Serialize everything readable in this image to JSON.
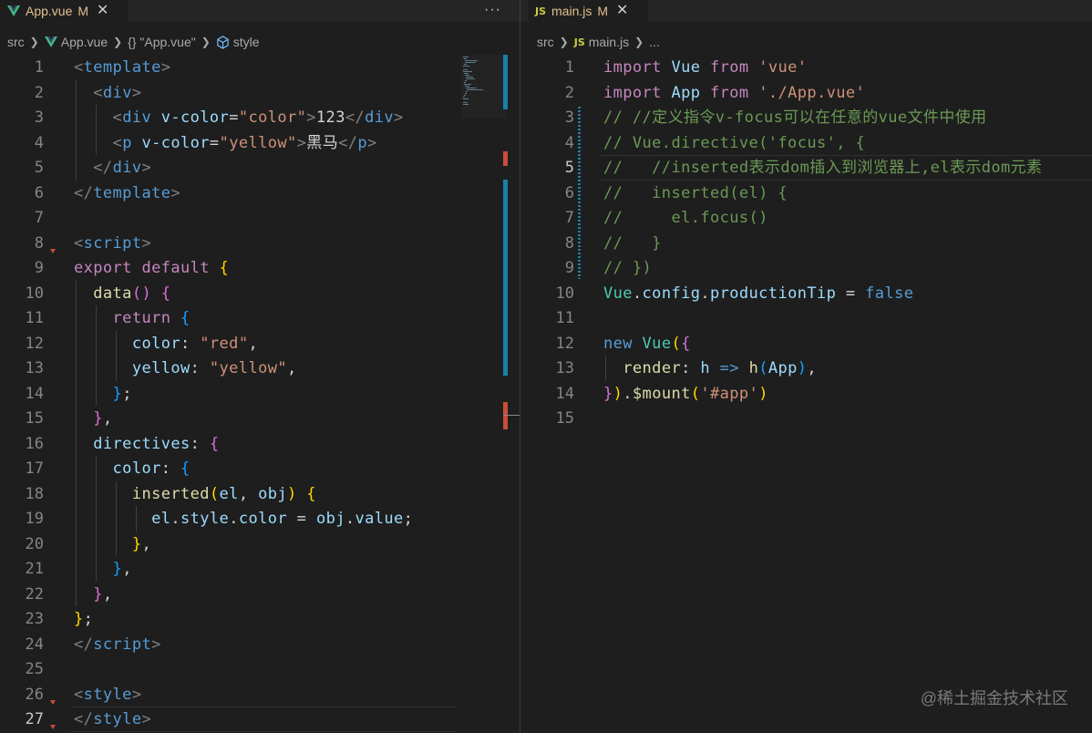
{
  "left": {
    "tab": {
      "label": "App.vue",
      "status": "M",
      "icon": "vue-icon"
    },
    "more_label": "···",
    "breadcrumb": [
      "src",
      "App.vue",
      "{} \"App.vue\"",
      "style"
    ],
    "lines": [
      {
        "n": "1",
        "tokens": [
          [
            "t-punct",
            "<"
          ],
          [
            "t-tag",
            "template"
          ],
          [
            "t-punct",
            ">"
          ]
        ]
      },
      {
        "n": "2",
        "tokens": [
          [
            "t-text",
            "  "
          ],
          [
            "t-punct",
            "<"
          ],
          [
            "t-tag",
            "div"
          ],
          [
            "t-punct",
            ">"
          ]
        ]
      },
      {
        "n": "3",
        "tokens": [
          [
            "t-text",
            "    "
          ],
          [
            "t-punct",
            "<"
          ],
          [
            "t-tag",
            "div"
          ],
          [
            "t-text",
            " "
          ],
          [
            "t-attr",
            "v-color"
          ],
          [
            "t-text",
            "="
          ],
          [
            "t-str",
            "\"color\""
          ],
          [
            "t-punct",
            ">"
          ],
          [
            "t-text",
            "123"
          ],
          [
            "t-punct",
            "</"
          ],
          [
            "t-tag",
            "div"
          ],
          [
            "t-punct",
            ">"
          ]
        ]
      },
      {
        "n": "4",
        "tokens": [
          [
            "t-text",
            "    "
          ],
          [
            "t-punct",
            "<"
          ],
          [
            "t-tag",
            "p"
          ],
          [
            "t-text",
            " "
          ],
          [
            "t-attr",
            "v-color"
          ],
          [
            "t-text",
            "="
          ],
          [
            "t-str",
            "\"yellow\""
          ],
          [
            "t-punct",
            ">"
          ],
          [
            "t-text",
            "黑马"
          ],
          [
            "t-punct",
            "</"
          ],
          [
            "t-tag",
            "p"
          ],
          [
            "t-punct",
            ">"
          ]
        ]
      },
      {
        "n": "5",
        "tokens": [
          [
            "t-text",
            "  "
          ],
          [
            "t-punct",
            "</"
          ],
          [
            "t-tag",
            "div"
          ],
          [
            "t-punct",
            ">"
          ]
        ]
      },
      {
        "n": "6",
        "tokens": [
          [
            "t-punct",
            "</"
          ],
          [
            "t-tag",
            "template"
          ],
          [
            "t-punct",
            ">"
          ]
        ]
      },
      {
        "n": "7",
        "tokens": []
      },
      {
        "n": "8",
        "tokens": [
          [
            "t-punct",
            "<"
          ],
          [
            "t-tag",
            "script"
          ],
          [
            "t-punct",
            ">"
          ]
        ]
      },
      {
        "n": "9",
        "tokens": [
          [
            "t-kw",
            "export"
          ],
          [
            "t-text",
            " "
          ],
          [
            "t-kw",
            "default"
          ],
          [
            "t-text",
            " "
          ],
          [
            "t-b1",
            "{"
          ]
        ]
      },
      {
        "n": "10",
        "tokens": [
          [
            "t-text",
            "  "
          ],
          [
            "t-fn",
            "data"
          ],
          [
            "t-b2",
            "()"
          ],
          [
            "t-text",
            " "
          ],
          [
            "t-b2",
            "{"
          ]
        ]
      },
      {
        "n": "11",
        "tokens": [
          [
            "t-text",
            "    "
          ],
          [
            "t-kw",
            "return"
          ],
          [
            "t-text",
            " "
          ],
          [
            "t-b3",
            "{"
          ]
        ]
      },
      {
        "n": "12",
        "tokens": [
          [
            "t-text",
            "      "
          ],
          [
            "t-var",
            "color"
          ],
          [
            "t-text",
            ": "
          ],
          [
            "t-str",
            "\"red\""
          ],
          [
            "t-text",
            ","
          ]
        ]
      },
      {
        "n": "13",
        "tokens": [
          [
            "t-text",
            "      "
          ],
          [
            "t-var",
            "yellow"
          ],
          [
            "t-text",
            ": "
          ],
          [
            "t-str",
            "\"yellow\""
          ],
          [
            "t-text",
            ","
          ]
        ]
      },
      {
        "n": "14",
        "tokens": [
          [
            "t-text",
            "    "
          ],
          [
            "t-b3",
            "}"
          ],
          [
            "t-text",
            ";"
          ]
        ]
      },
      {
        "n": "15",
        "tokens": [
          [
            "t-text",
            "  "
          ],
          [
            "t-b2",
            "}"
          ],
          [
            "t-text",
            ","
          ]
        ]
      },
      {
        "n": "16",
        "tokens": [
          [
            "t-text",
            "  "
          ],
          [
            "t-var",
            "directives"
          ],
          [
            "t-text",
            ": "
          ],
          [
            "t-b2",
            "{"
          ]
        ]
      },
      {
        "n": "17",
        "tokens": [
          [
            "t-text",
            "    "
          ],
          [
            "t-var",
            "color"
          ],
          [
            "t-text",
            ": "
          ],
          [
            "t-b3",
            "{"
          ]
        ]
      },
      {
        "n": "18",
        "tokens": [
          [
            "t-text",
            "      "
          ],
          [
            "t-fn",
            "inserted"
          ],
          [
            "t-b1",
            "("
          ],
          [
            "t-var",
            "el"
          ],
          [
            "t-text",
            ", "
          ],
          [
            "t-var",
            "obj"
          ],
          [
            "t-b1",
            ")"
          ],
          [
            "t-text",
            " "
          ],
          [
            "t-b1",
            "{"
          ]
        ]
      },
      {
        "n": "19",
        "tokens": [
          [
            "t-text",
            "        "
          ],
          [
            "t-var",
            "el"
          ],
          [
            "t-text",
            "."
          ],
          [
            "t-var",
            "style"
          ],
          [
            "t-text",
            "."
          ],
          [
            "t-var",
            "color"
          ],
          [
            "t-text",
            " = "
          ],
          [
            "t-var",
            "obj"
          ],
          [
            "t-text",
            "."
          ],
          [
            "t-var",
            "value"
          ],
          [
            "t-text",
            ";"
          ]
        ]
      },
      {
        "n": "20",
        "tokens": [
          [
            "t-text",
            "      "
          ],
          [
            "t-b1",
            "}"
          ],
          [
            "t-text",
            ","
          ]
        ]
      },
      {
        "n": "21",
        "tokens": [
          [
            "t-text",
            "    "
          ],
          [
            "t-b3",
            "}"
          ],
          [
            "t-text",
            ","
          ]
        ]
      },
      {
        "n": "22",
        "tokens": [
          [
            "t-text",
            "  "
          ],
          [
            "t-b2",
            "}"
          ],
          [
            "t-text",
            ","
          ]
        ]
      },
      {
        "n": "23",
        "tokens": [
          [
            "t-b1",
            "}"
          ],
          [
            "t-text",
            ";"
          ]
        ]
      },
      {
        "n": "24",
        "tokens": [
          [
            "t-punct",
            "</"
          ],
          [
            "t-tag",
            "script"
          ],
          [
            "t-punct",
            ">"
          ]
        ]
      },
      {
        "n": "25",
        "tokens": []
      },
      {
        "n": "26",
        "tokens": [
          [
            "t-punct",
            "<"
          ],
          [
            "t-tag",
            "style"
          ],
          [
            "t-punct",
            ">"
          ]
        ]
      },
      {
        "n": "27",
        "tokens": [
          [
            "t-punct",
            "</"
          ],
          [
            "t-tag",
            "style"
          ],
          [
            "t-punct",
            ">"
          ]
        ]
      }
    ]
  },
  "right": {
    "tab": {
      "label": "main.js",
      "status": "M",
      "icon_text": "JS"
    },
    "breadcrumb": [
      "src",
      "main.js",
      "..."
    ],
    "lines": [
      {
        "n": "1",
        "tokens": [
          [
            "t-kw",
            "import"
          ],
          [
            "t-text",
            " "
          ],
          [
            "t-var",
            "Vue"
          ],
          [
            "t-text",
            " "
          ],
          [
            "t-kw",
            "from"
          ],
          [
            "t-text",
            " "
          ],
          [
            "t-str",
            "'vue'"
          ]
        ]
      },
      {
        "n": "2",
        "tokens": [
          [
            "t-kw",
            "import"
          ],
          [
            "t-text",
            " "
          ],
          [
            "t-var",
            "App"
          ],
          [
            "t-text",
            " "
          ],
          [
            "t-kw",
            "from"
          ],
          [
            "t-text",
            " "
          ],
          [
            "t-str",
            "'./App.vue'"
          ]
        ]
      },
      {
        "n": "3",
        "tokens": [
          [
            "t-cmt",
            "// //定义指令v-focus可以在任意的vue文件中使用"
          ]
        ]
      },
      {
        "n": "4",
        "tokens": [
          [
            "t-cmt",
            "// Vue.directive('focus', {"
          ]
        ]
      },
      {
        "n": "5",
        "tokens": [
          [
            "t-cmt",
            "//   //inserted表示dom插入到浏览器上,el表示dom元素"
          ]
        ]
      },
      {
        "n": "6",
        "tokens": [
          [
            "t-cmt",
            "//   inserted(el) {"
          ]
        ]
      },
      {
        "n": "7",
        "tokens": [
          [
            "t-cmt",
            "//     el.focus()"
          ]
        ]
      },
      {
        "n": "8",
        "tokens": [
          [
            "t-cmt",
            "//   }"
          ]
        ]
      },
      {
        "n": "9",
        "tokens": [
          [
            "t-cmt",
            "// })"
          ]
        ]
      },
      {
        "n": "10",
        "tokens": [
          [
            "t-cls",
            "Vue"
          ],
          [
            "t-text",
            "."
          ],
          [
            "t-var",
            "config"
          ],
          [
            "t-text",
            "."
          ],
          [
            "t-var",
            "productionTip"
          ],
          [
            "t-text",
            " = "
          ],
          [
            "t-bool",
            "false"
          ]
        ]
      },
      {
        "n": "11",
        "tokens": []
      },
      {
        "n": "12",
        "tokens": [
          [
            "t-bool",
            "new"
          ],
          [
            "t-text",
            " "
          ],
          [
            "t-cls",
            "Vue"
          ],
          [
            "t-b1",
            "("
          ],
          [
            "t-b2",
            "{"
          ]
        ]
      },
      {
        "n": "13",
        "tokens": [
          [
            "t-text",
            "  "
          ],
          [
            "t-fn",
            "render"
          ],
          [
            "t-text",
            ": "
          ],
          [
            "t-var",
            "h"
          ],
          [
            "t-text",
            " "
          ],
          [
            "t-bool",
            "=>"
          ],
          [
            "t-text",
            " "
          ],
          [
            "t-fn",
            "h"
          ],
          [
            "t-b3",
            "("
          ],
          [
            "t-var",
            "App"
          ],
          [
            "t-b3",
            ")"
          ],
          [
            "t-text",
            ","
          ]
        ]
      },
      {
        "n": "14",
        "tokens": [
          [
            "t-b2",
            "}"
          ],
          [
            "t-b1",
            ")"
          ],
          [
            "t-text",
            "."
          ],
          [
            "t-fn",
            "$mount"
          ],
          [
            "t-b1",
            "("
          ],
          [
            "t-str",
            "'#app'"
          ],
          [
            "t-b1",
            ")"
          ]
        ]
      },
      {
        "n": "15",
        "tokens": []
      }
    ]
  },
  "watermark": "@稀土掘金技术社区",
  "colors": {
    "modified": "#e2c08d",
    "background": "#1e1e1e",
    "comment": "#6a9955"
  }
}
